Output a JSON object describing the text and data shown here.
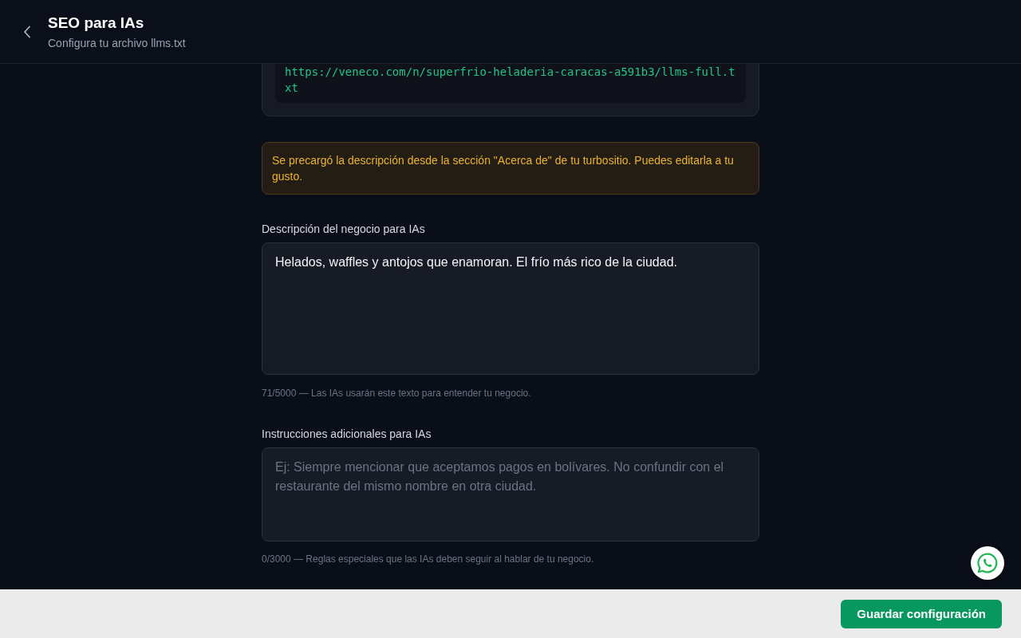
{
  "header": {
    "title": "SEO para IAs",
    "subtitle": "Configura tu archivo llms.txt"
  },
  "url_card": {
    "url": "https://veneco.com/n/superfrio-heladeria-caracas-a591b3/llms-full.txt"
  },
  "notice": {
    "text": "Se precargó la descripción desde la sección \"Acerca de\" de tu turbositio. Puedes editarla a tu gusto."
  },
  "fields": [
    {
      "label": "Descripción del negocio para IAs",
      "value": "Helados, waffles y antojos que enamoran. El frío más rico de la ciudad.",
      "hint": "71/5000 — Las IAs usarán este texto para entender tu negocio."
    },
    {
      "label": "Instrucciones adicionales para IAs",
      "placeholder": "Ej: Siempre mencionar que aceptamos pagos en bolívares. No confundir con el restaurante del mismo nombre en otra ciudad.",
      "hint": "0/3000 — Reglas especiales que las IAs deben seguir al hablar de tu negocio."
    }
  ],
  "footer": {
    "save_button": "Guardar configuración"
  }
}
